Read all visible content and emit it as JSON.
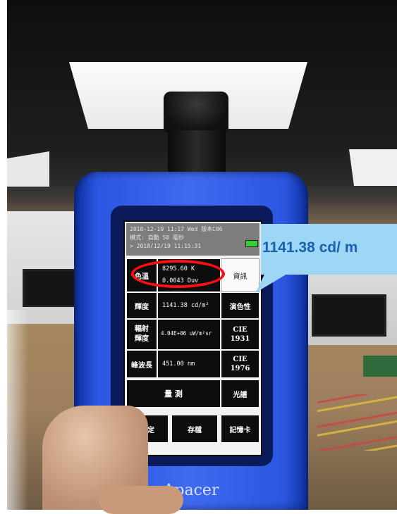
{
  "device": {
    "brand": "Apacer",
    "status_lines": [
      "2018-12-19 11:17 Wed 版本C06",
      "模式: 自動   50  毫秒",
      "> 2018/12/19 11:15:31"
    ],
    "rows": [
      {
        "label": "色溫",
        "value_lines": [
          "8295.60   K",
          "0.0043   Duv"
        ],
        "side": "資訊"
      },
      {
        "label": "輝度",
        "value_lines": [
          "1141.38   cd/m²"
        ],
        "side": "演色性"
      },
      {
        "label": "輻射\n輝度",
        "value_lines": [
          "4.04E+06 uW/m²sr"
        ],
        "side": "CIE\n1931"
      },
      {
        "label": "峰波長",
        "value_lines": [
          "451.00     nm"
        ],
        "side": "CIE\n1976"
      }
    ],
    "measure_label": "量   測",
    "spectrum_label": "光譜",
    "bottom_buttons": [
      "設定",
      "存檔",
      "記憶卡"
    ]
  },
  "callout": {
    "text": "1141.38 cd/ m",
    "color": "#9ed6f5",
    "highlight_color": "#ff1010"
  }
}
